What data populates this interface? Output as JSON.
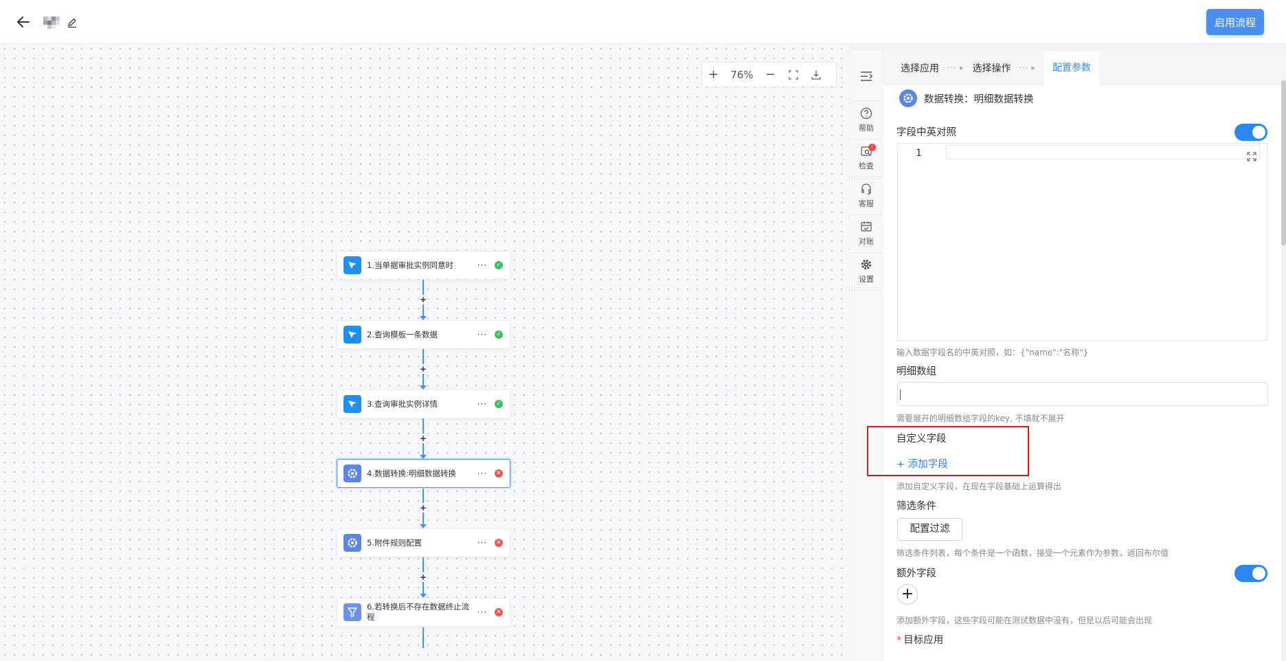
{
  "header": {
    "enable_label": "启用流程"
  },
  "zoom": {
    "value": "76%"
  },
  "nodes": [
    {
      "label": "1.当单据审批实例同意时",
      "status": "ok",
      "icon": "pointer-icon"
    },
    {
      "label": "2.查询模板一条数据",
      "status": "ok",
      "icon": "pointer-icon"
    },
    {
      "label": "3.查询审批实例详情",
      "status": "ok",
      "icon": "pointer-icon"
    },
    {
      "label": "4.数据转换:明细数据转换",
      "status": "error",
      "icon": "gear-icon"
    },
    {
      "label": "5.附件规则配置",
      "status": "error",
      "icon": "gear-icon"
    },
    {
      "label": "6.若转换后不存在数据终止流程",
      "status": "error",
      "icon": "filter-icon"
    }
  ],
  "node_dots": "···",
  "connector_plus": "+",
  "tools": [
    {
      "label": "帮助",
      "icon": "help-icon"
    },
    {
      "label": "检查",
      "icon": "check-icon",
      "badge": "!"
    },
    {
      "label": "客服",
      "icon": "headset-icon"
    },
    {
      "label": "对账",
      "icon": "calendar-icon"
    },
    {
      "label": "设置",
      "icon": "settings-icon"
    }
  ],
  "panel": {
    "steps": [
      "选择应用",
      "选择操作",
      "配置参数"
    ],
    "step_sep": "···",
    "title": "数据转换：明细数据转换",
    "field_mapping": {
      "label": "字段中英对照",
      "enabled": true,
      "editor_line": "1",
      "hint": "输入数据字段名的中英对照，如：{\"name\":\"名称\"}"
    },
    "detail_array": {
      "label": "明细数组",
      "value": "",
      "hint": "需要展开的明细数组字段的key, 不填就不展开"
    },
    "custom_fields": {
      "label": "自定义字段",
      "add_label": "+ 添加字段",
      "hint": "添加自定义字段，在现在字段基础上运算得出"
    },
    "filter": {
      "label": "筛选条件",
      "button_label": "配置过滤",
      "hint": "筛选条件列表，每个条件是一个函数，接受一个元素作为参数，返回布尔值"
    },
    "extra_fields": {
      "label": "额外字段",
      "enabled": true,
      "add_symbol": "+",
      "hint": "添加额外字段，这些字段可能在测试数据中没有，但是以后可能会出现"
    },
    "target_app": {
      "required_mark": "*",
      "label": "目标应用"
    }
  },
  "colors": {
    "accent": "#2b87f2",
    "primary_button": "#4a90f0",
    "ok": "#3bbf62",
    "error": "#f05454",
    "highlight": "#e11414"
  }
}
